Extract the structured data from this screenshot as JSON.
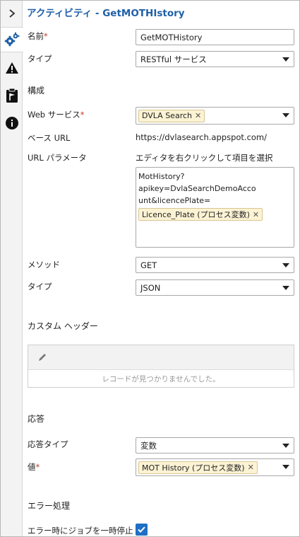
{
  "title": "アクティビティ - GetMOTHIstory",
  "sidebar": {
    "items": [
      {
        "icon": "chevron-right-icon"
      },
      {
        "icon": "gears-icon"
      },
      {
        "icon": "warning-icon"
      },
      {
        "icon": "clipboard-flag-icon"
      },
      {
        "icon": "info-icon"
      }
    ]
  },
  "form": {
    "name_label": "名前",
    "name_value": "GetMOTHistory",
    "type_label": "タイプ",
    "type_value": "RESTful サービス",
    "config_section": "構成",
    "webservice_label": "Web サービス",
    "webservice_value": "DVLA Search",
    "baseurl_label": "ベース URL",
    "baseurl_value": "https://dvlasearch.appspot.com/",
    "urlparam_label": "URL パラメータ",
    "urlparam_hint": "エディタを右クリックして項目を選択",
    "urlparam_line1": "MotHistory?apikey=DvlaSearchDemoAcco",
    "urlparam_line2": "unt&licencePlate=",
    "urlparam_chip": "Licence_Plate (プロセス変数)",
    "method_label": "メソッド",
    "method_value": "GET",
    "format_label": "タイプ",
    "format_value": "JSON",
    "custom_header_section": "カスタム ヘッダー",
    "no_records": "レコードが見つかりませんでした。",
    "response_section": "応答",
    "response_type_label": "応答タイプ",
    "response_type_value": "変数",
    "value_label": "値",
    "value_chip": "MOT History (プロセス変数)",
    "error_section": "エラー処理",
    "pause_label": "エラー時にジョブを一時停止",
    "pause_checked": true
  },
  "colors": {
    "accent": "#1f6fc4",
    "title": "#1f5fa8",
    "required": "#c0392b",
    "chip_bg": "#fcf3d4"
  }
}
